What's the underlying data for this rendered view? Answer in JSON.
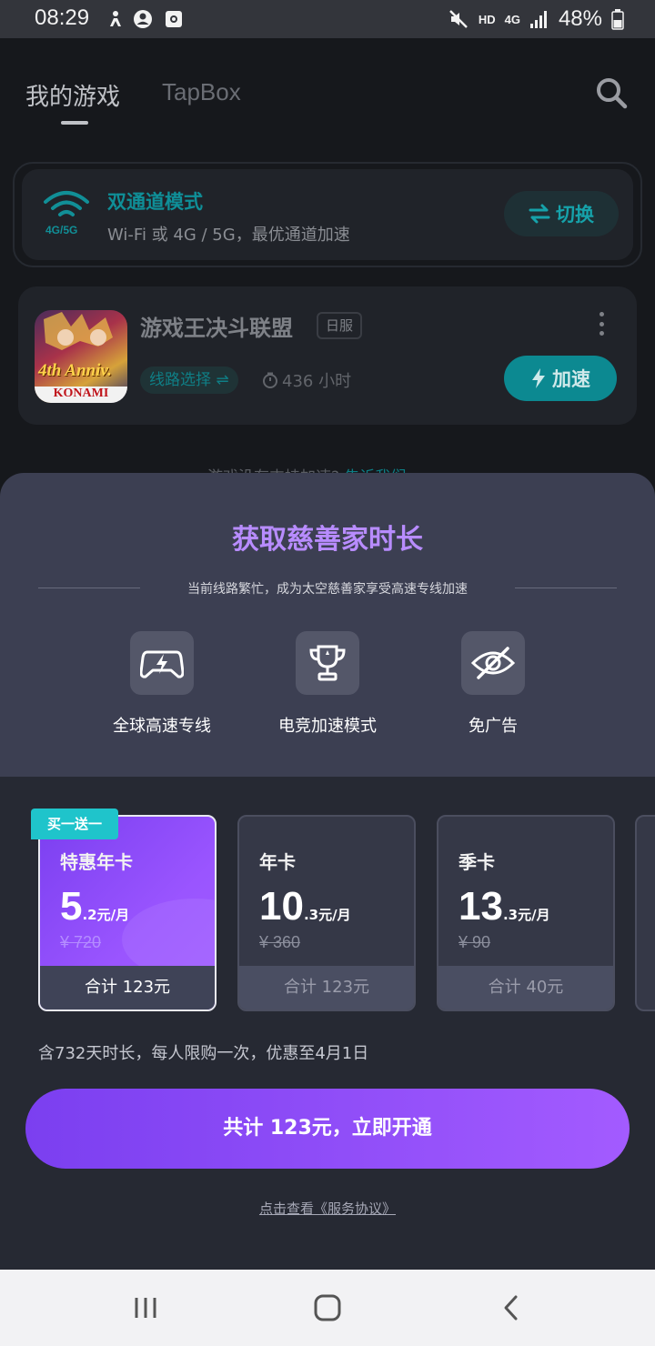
{
  "status_bar": {
    "time": "08:29",
    "network": "HD",
    "signal": "4G",
    "battery": "48%"
  },
  "app": {
    "tabs": [
      {
        "label": "我的游戏"
      },
      {
        "label": "TapBox"
      }
    ],
    "mode_card": {
      "icon_label": "4G/5G",
      "title": "双通道模式",
      "subtitle": "Wi-Fi 或 4G / 5G，最优通道加速",
      "switch_label": "切换"
    },
    "game_card": {
      "name": "游戏王决斗联盟",
      "region": "日服",
      "route_label": "线路选择 ⇌",
      "hours": "436 小时",
      "accelerate_label": "加速",
      "icon_text_1": "4th Anniv.",
      "icon_text_2": "KONAMI"
    },
    "unsupported_text": "游戏没有支持加速?",
    "unsupported_link": "告诉我们"
  },
  "sheet": {
    "title": "获取慈善家时长",
    "subtitle": "当前线路繁忙，成为太空慈善家享受高速专线加速",
    "features": [
      {
        "label": "全球高速专线",
        "icon": "gamepad-lightning-icon"
      },
      {
        "label": "电竞加速模式",
        "icon": "trophy-icon"
      },
      {
        "label": "免广告",
        "icon": "eye-off-icon"
      }
    ],
    "promo_tag": "买一送一",
    "plans": [
      {
        "name": "特惠年卡",
        "price_main": "5",
        "price_sub": ".2元/月",
        "original": "¥ 720",
        "total": "合计 123元",
        "selected": true
      },
      {
        "name": "年卡",
        "price_main": "10",
        "price_sub": ".3元/月",
        "original": "¥ 360",
        "total": "合计 123元",
        "selected": false
      },
      {
        "name": "季卡",
        "price_main": "13",
        "price_sub": ".3元/月",
        "original": "¥ 90",
        "total": "合计 40元",
        "selected": false
      }
    ],
    "note": "含732天时长，每人限购一次，优惠至4月1日",
    "buy_label": "共计 123元，立即开通",
    "agreement": "点击查看《服务协议》"
  },
  "colors": {
    "accent_purple": "#9a55ff",
    "accent_teal": "#0c8991",
    "title_purple": "#b88cff"
  }
}
